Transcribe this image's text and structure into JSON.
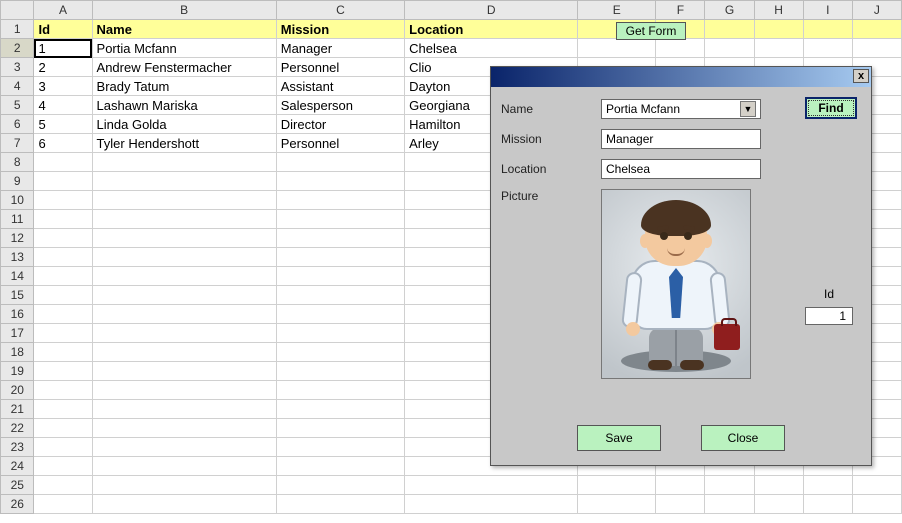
{
  "columns": [
    "A",
    "B",
    "C",
    "D",
    "E",
    "F",
    "G",
    "H",
    "I",
    "J"
  ],
  "header": {
    "id": "Id",
    "name": "Name",
    "mission": "Mission",
    "location": "Location"
  },
  "rows": [
    {
      "id": 1,
      "name": "Portia Mcfann",
      "mission": "Manager",
      "location": "Chelsea"
    },
    {
      "id": 2,
      "name": "Andrew Fenstermacher",
      "mission": "Personnel",
      "location": "Clio"
    },
    {
      "id": 3,
      "name": "Brady Tatum",
      "mission": "Assistant",
      "location": "Dayton"
    },
    {
      "id": 4,
      "name": "Lashawn Mariska",
      "mission": "Salesperson",
      "location": "Georgiana"
    },
    {
      "id": 5,
      "name": "Linda Golda",
      "mission": "Director",
      "location": "Hamilton"
    },
    {
      "id": 6,
      "name": "Tyler Hendershott",
      "mission": "Personnel",
      "location": "Arley"
    }
  ],
  "total_visible_rows": 26,
  "selected_cell": "A2",
  "getform_label": "Get Form",
  "form": {
    "labels": {
      "name": "Name",
      "mission": "Mission",
      "location": "Location",
      "picture": "Picture",
      "id": "Id"
    },
    "name_value": "Portia Mcfann",
    "mission_value": "Manager",
    "location_value": "Chelsea",
    "id_value": "1",
    "find_label": "Find",
    "save_label": "Save",
    "close_label": "Close",
    "close_x": "x"
  }
}
